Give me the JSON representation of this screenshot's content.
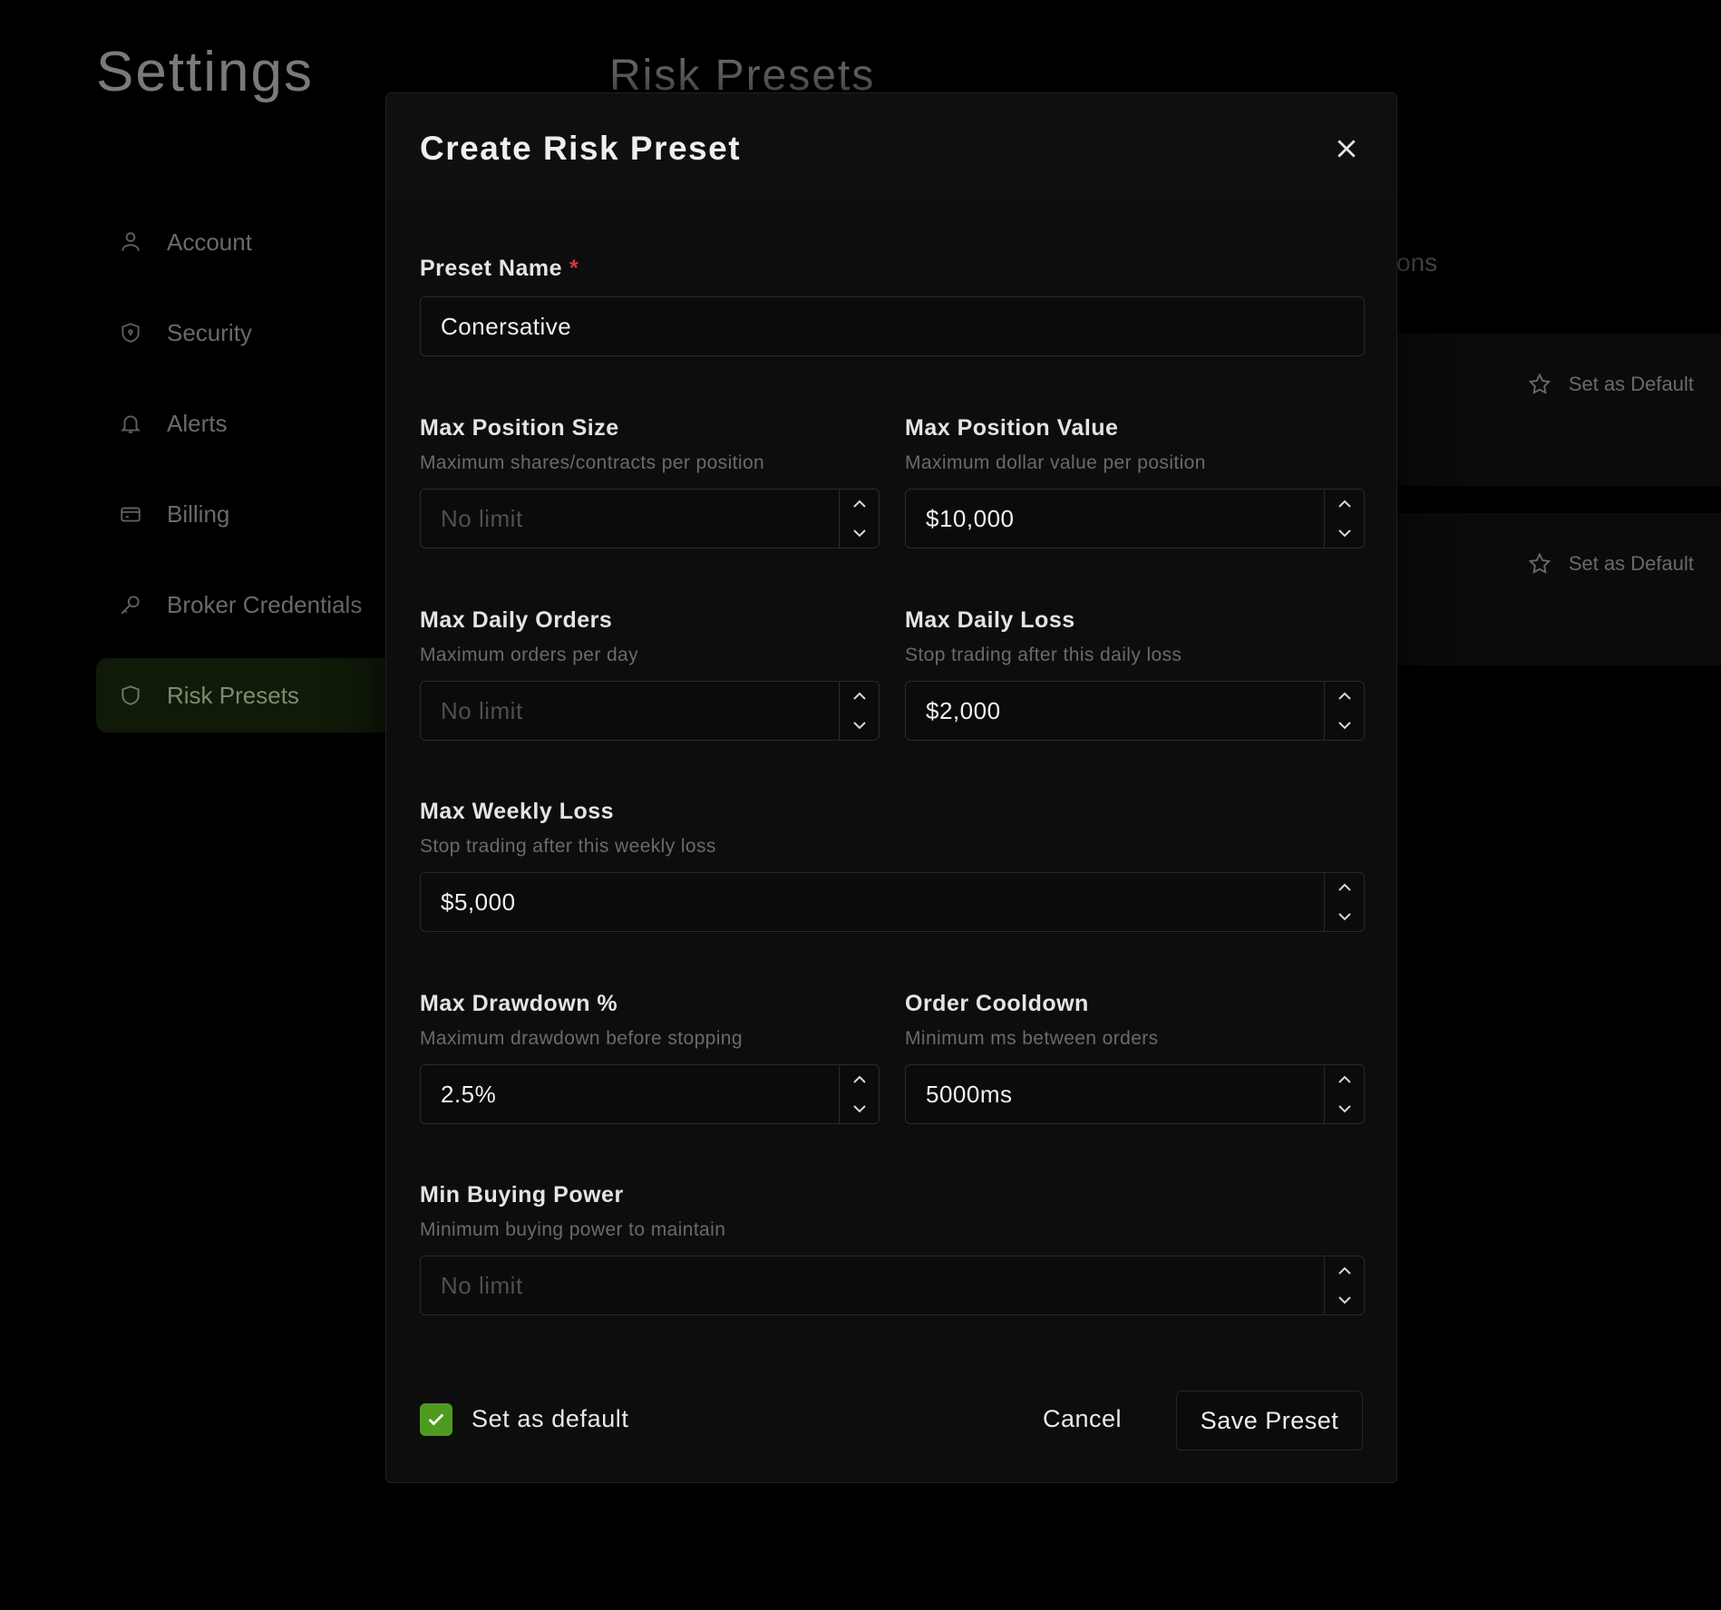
{
  "page": {
    "settings_title": "Settings",
    "section_title": "Risk Presets",
    "ghost_text": "ons",
    "sidebar": {
      "items": [
        {
          "label": "Account",
          "icon": "user-icon"
        },
        {
          "label": "Security",
          "icon": "shield-icon"
        },
        {
          "label": "Alerts",
          "icon": "bell-icon"
        },
        {
          "label": "Billing",
          "icon": "credit-card-icon"
        },
        {
          "label": "Broker Credentials",
          "icon": "key-icon"
        },
        {
          "label": "Risk Presets",
          "icon": "shield-icon",
          "active": true
        }
      ]
    },
    "preset_cards": [
      {
        "set_default_label": "Set as Default"
      },
      {
        "set_default_label": "Set as Default"
      }
    ]
  },
  "modal": {
    "title": "Create Risk Preset",
    "preset_name": {
      "label": "Preset Name",
      "required_mark": "*",
      "value": "Conersative"
    },
    "max_position_size": {
      "label": "Max Position Size",
      "description": "Maximum shares/contracts per position",
      "value": "",
      "placeholder": "No limit"
    },
    "max_position_value": {
      "label": "Max Position Value",
      "description": "Maximum dollar value per position",
      "value": "$10,000",
      "placeholder": "No limit"
    },
    "max_daily_orders": {
      "label": "Max Daily Orders",
      "description": "Maximum orders per day",
      "value": "",
      "placeholder": "No limit"
    },
    "max_daily_loss": {
      "label": "Max Daily Loss",
      "description": "Stop trading after this daily loss",
      "value": "$2,000",
      "placeholder": "No limit"
    },
    "max_weekly_loss": {
      "label": "Max Weekly Loss",
      "description": "Stop trading after this weekly loss",
      "value": "$5,000",
      "placeholder": "No limit"
    },
    "max_drawdown": {
      "label": "Max Drawdown %",
      "description": "Maximum drawdown before stopping",
      "value": "2.5%",
      "placeholder": "No limit"
    },
    "order_cooldown": {
      "label": "Order Cooldown",
      "description": "Minimum ms between orders",
      "value": "5000ms",
      "placeholder": "No limit"
    },
    "min_buying_power": {
      "label": "Min Buying Power",
      "description": "Minimum buying power to maintain",
      "value": "",
      "placeholder": "No limit"
    },
    "footer": {
      "set_default_label": "Set as default",
      "set_default_checked": true,
      "cancel_label": "Cancel",
      "save_label": "Save Preset"
    }
  },
  "colors": {
    "accent": "#4d9b1f",
    "required": "#d03a3a",
    "modal_bg": "#0d0d0d"
  }
}
